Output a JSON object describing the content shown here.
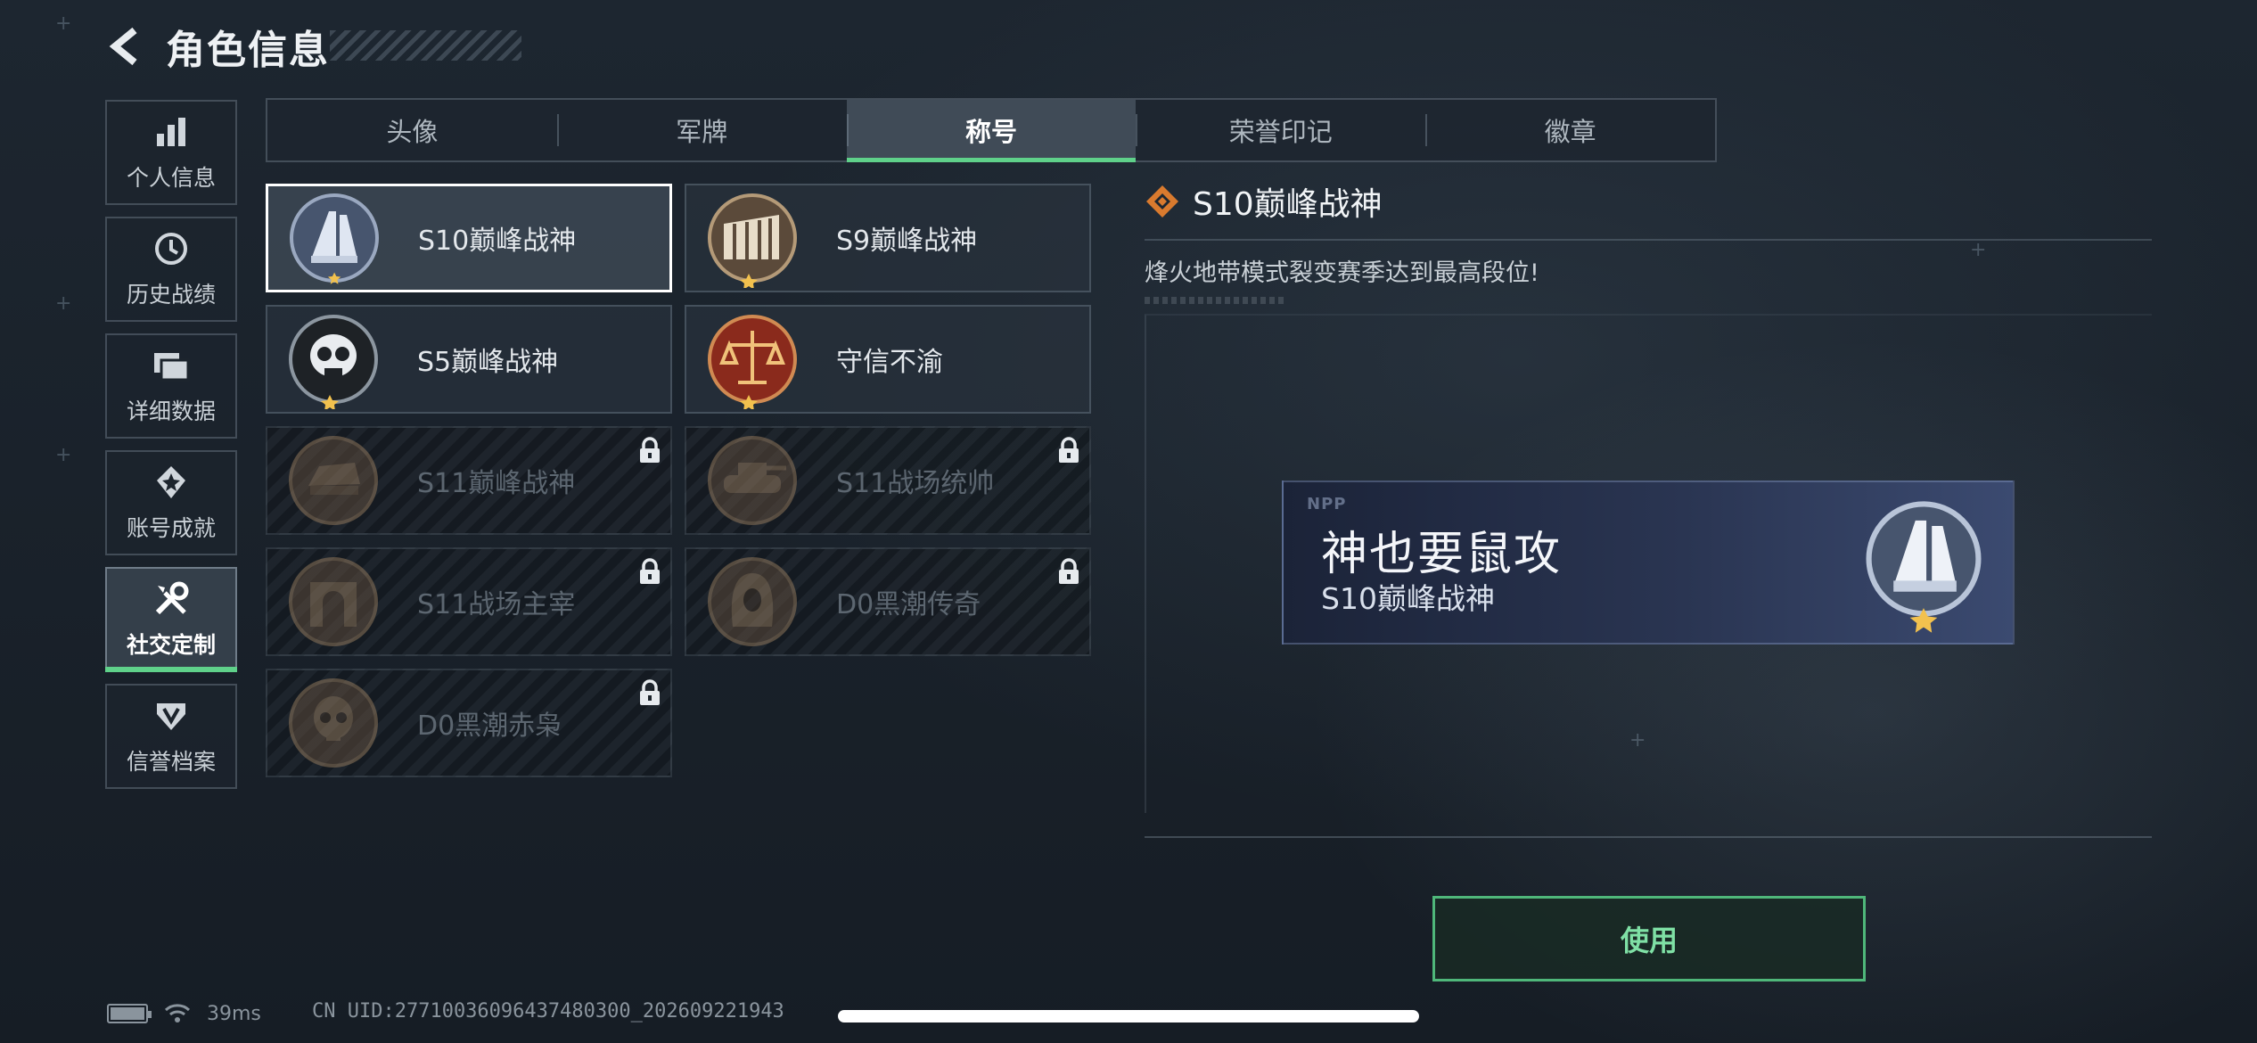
{
  "header": {
    "title": "角色信息"
  },
  "sidebar": {
    "items": [
      {
        "label": "个人信息",
        "icon": "bar-chart-icon"
      },
      {
        "label": "历史战绩",
        "icon": "clock-icon"
      },
      {
        "label": "详细数据",
        "icon": "folder-icon"
      },
      {
        "label": "账号成就",
        "icon": "medal-icon"
      },
      {
        "label": "社交定制",
        "icon": "tools-icon",
        "active": true
      },
      {
        "label": "信誉档案",
        "icon": "shield-icon"
      }
    ]
  },
  "tabs": [
    {
      "label": "头像"
    },
    {
      "label": "军牌"
    },
    {
      "label": "称号",
      "active": true
    },
    {
      "label": "荣誉印记"
    },
    {
      "label": "徽章"
    }
  ],
  "titles": [
    {
      "name": "S10巅峰战神",
      "locked": false,
      "selected": true,
      "emblem": "s10-emblem-icon"
    },
    {
      "name": "S9巅峰战神",
      "locked": false,
      "emblem": "s9-emblem-icon"
    },
    {
      "name": "S5巅峰战神",
      "locked": false,
      "emblem": "s5-emblem-icon"
    },
    {
      "name": "守信不渝",
      "locked": false,
      "emblem": "scales-emblem-icon"
    },
    {
      "name": "S11巅峰战神",
      "locked": true,
      "emblem": "s11-emblem-icon"
    },
    {
      "name": "S11战场统帅",
      "locked": true,
      "emblem": "tank-emblem-icon"
    },
    {
      "name": "S11战场主宰",
      "locked": true,
      "emblem": "arch-emblem-icon"
    },
    {
      "name": "D0黑潮传奇",
      "locked": true,
      "emblem": "hood-emblem-icon"
    },
    {
      "name": "D0黑潮赤枭",
      "locked": true,
      "emblem": "skull-emblem-icon"
    }
  ],
  "detail": {
    "title": "S10巅峰战神",
    "description": "烽火地带模式裂变赛季达到最高段位!"
  },
  "nameplate": {
    "logo": "NPP",
    "player_name": "神也要鼠攻",
    "title": "S10巅峰战神"
  },
  "use_button": {
    "label": "使用"
  },
  "status_bar": {
    "ping": "39ms",
    "uid": "CN UID:27710036096437480300_202609221943"
  },
  "colors": {
    "accent": "#5fd18a",
    "use_button_border": "#4fb77a",
    "locked_text": "#5c6670",
    "nameplate_bg": "#2a3552"
  }
}
